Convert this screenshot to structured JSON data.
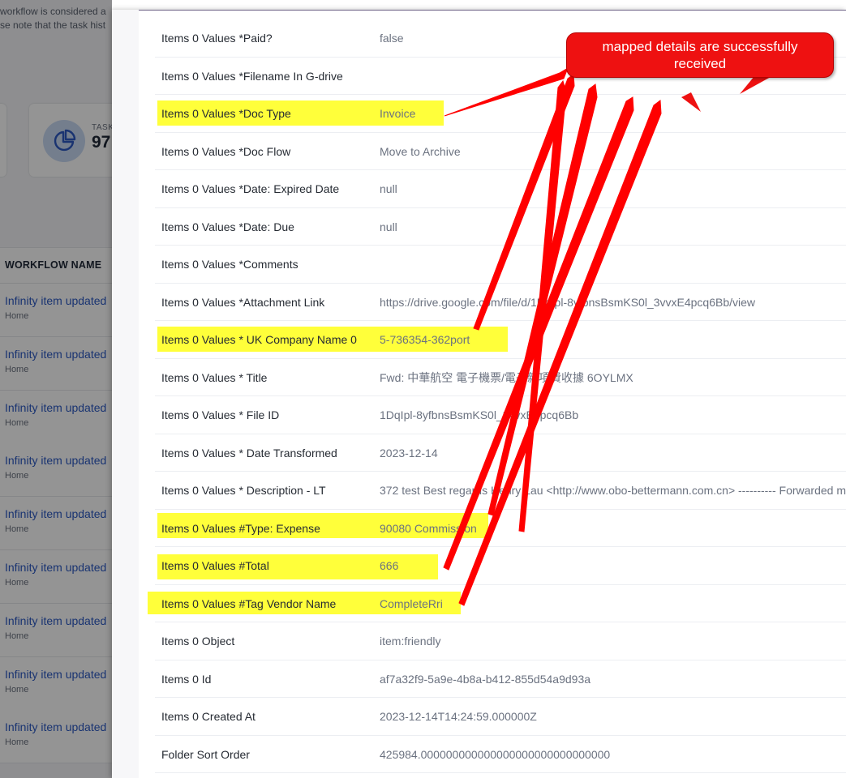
{
  "background": {
    "notice_line1": "workflow is considered a",
    "notice_line2": "se note that the task hist",
    "stat_label": "TASK",
    "stat_value": "97",
    "table_header": "WORKFLOW NAME",
    "rows": [
      {
        "title": "Infinity item updated",
        "sub": "Home"
      },
      {
        "title": "Infinity item updated",
        "sub": "Home"
      },
      {
        "title": "Infinity item updated",
        "sub": "Home"
      },
      {
        "title": "Infinity item updated",
        "sub": "Home"
      },
      {
        "title": "Infinity item updated",
        "sub": "Home"
      },
      {
        "title": "Infinity item updated",
        "sub": "Home"
      },
      {
        "title": "Infinity item updated",
        "sub": "Home"
      },
      {
        "title": "Infinity item updated",
        "sub": "Home"
      },
      {
        "title": "Infinity item updated",
        "sub": "Home"
      }
    ]
  },
  "details": {
    "rows": [
      {
        "key": "Items 0 Values *Paid?",
        "value": "false",
        "highlight": false
      },
      {
        "key": "Items 0 Values *Filename In G-drive",
        "value": "",
        "highlight": false
      },
      {
        "key": "Items 0 Values *Doc Type",
        "value": "Invoice",
        "highlight": true
      },
      {
        "key": "Items 0 Values *Doc Flow",
        "value": "Move to Archive",
        "highlight": false
      },
      {
        "key": "Items 0 Values *Date: Expired Date",
        "value": "null",
        "highlight": false
      },
      {
        "key": "Items 0 Values *Date: Due",
        "value": "null",
        "highlight": false
      },
      {
        "key": "Items 0 Values *Comments",
        "value": "",
        "highlight": false
      },
      {
        "key": "Items 0 Values *Attachment Link",
        "value": "https://drive.google.com/file/d/1DqIpl-8yfbnsBsmKS0l_3vvxE4pcq6Bb/view",
        "highlight": false
      },
      {
        "key": "Items 0 Values * UK Company Name 0",
        "value": "5-736354-362port",
        "highlight": true
      },
      {
        "key": "Items 0 Values * Title",
        "value": "Fwd: 中華航空 電子機票/電子雜項費收據 6OYLMX",
        "highlight": false
      },
      {
        "key": "Items 0 Values * File ID",
        "value": "1DqIpl-8yfbnsBsmKS0l_3vvxE4pcq6Bb",
        "highlight": false
      },
      {
        "key": "Items 0 Values * Date Transformed",
        "value": "2023-12-14",
        "highlight": false
      },
      {
        "key": "Items 0 Values * Description - LT",
        "value": "372 test Best regards Henry Lau <http://www.obo-bettermann.com.cn> ---------- Forwarded m",
        "highlight": false
      },
      {
        "key": "Items 0 Values #Type: Expense",
        "value": "90080 Commission",
        "highlight": true
      },
      {
        "key": "Items 0 Values #Total",
        "value": "666",
        "highlight": true
      },
      {
        "key": "Items 0 Values #Tag Vendor Name",
        "value": "CompleteRri",
        "highlight": true
      },
      {
        "key": "Items 0 Object",
        "value": "item:friendly",
        "highlight": false
      },
      {
        "key": "Items 0 Id",
        "value": "af7a32f9-5a9e-4b8a-b412-855d54a9d93a",
        "highlight": false
      },
      {
        "key": "Items 0 Created At",
        "value": "2023-12-14T14:24:59.000000Z",
        "highlight": false
      },
      {
        "key": "Folder Sort Order",
        "value": "425984.000000000000000000000000000000",
        "highlight": false
      }
    ]
  },
  "callout": {
    "line1": "mapped details are successfully",
    "line2": "received",
    "color": "#ee1111"
  },
  "colors": {
    "highlight": "#ffff3a",
    "link": "#2b59c3",
    "arrow": "#ff0000"
  }
}
